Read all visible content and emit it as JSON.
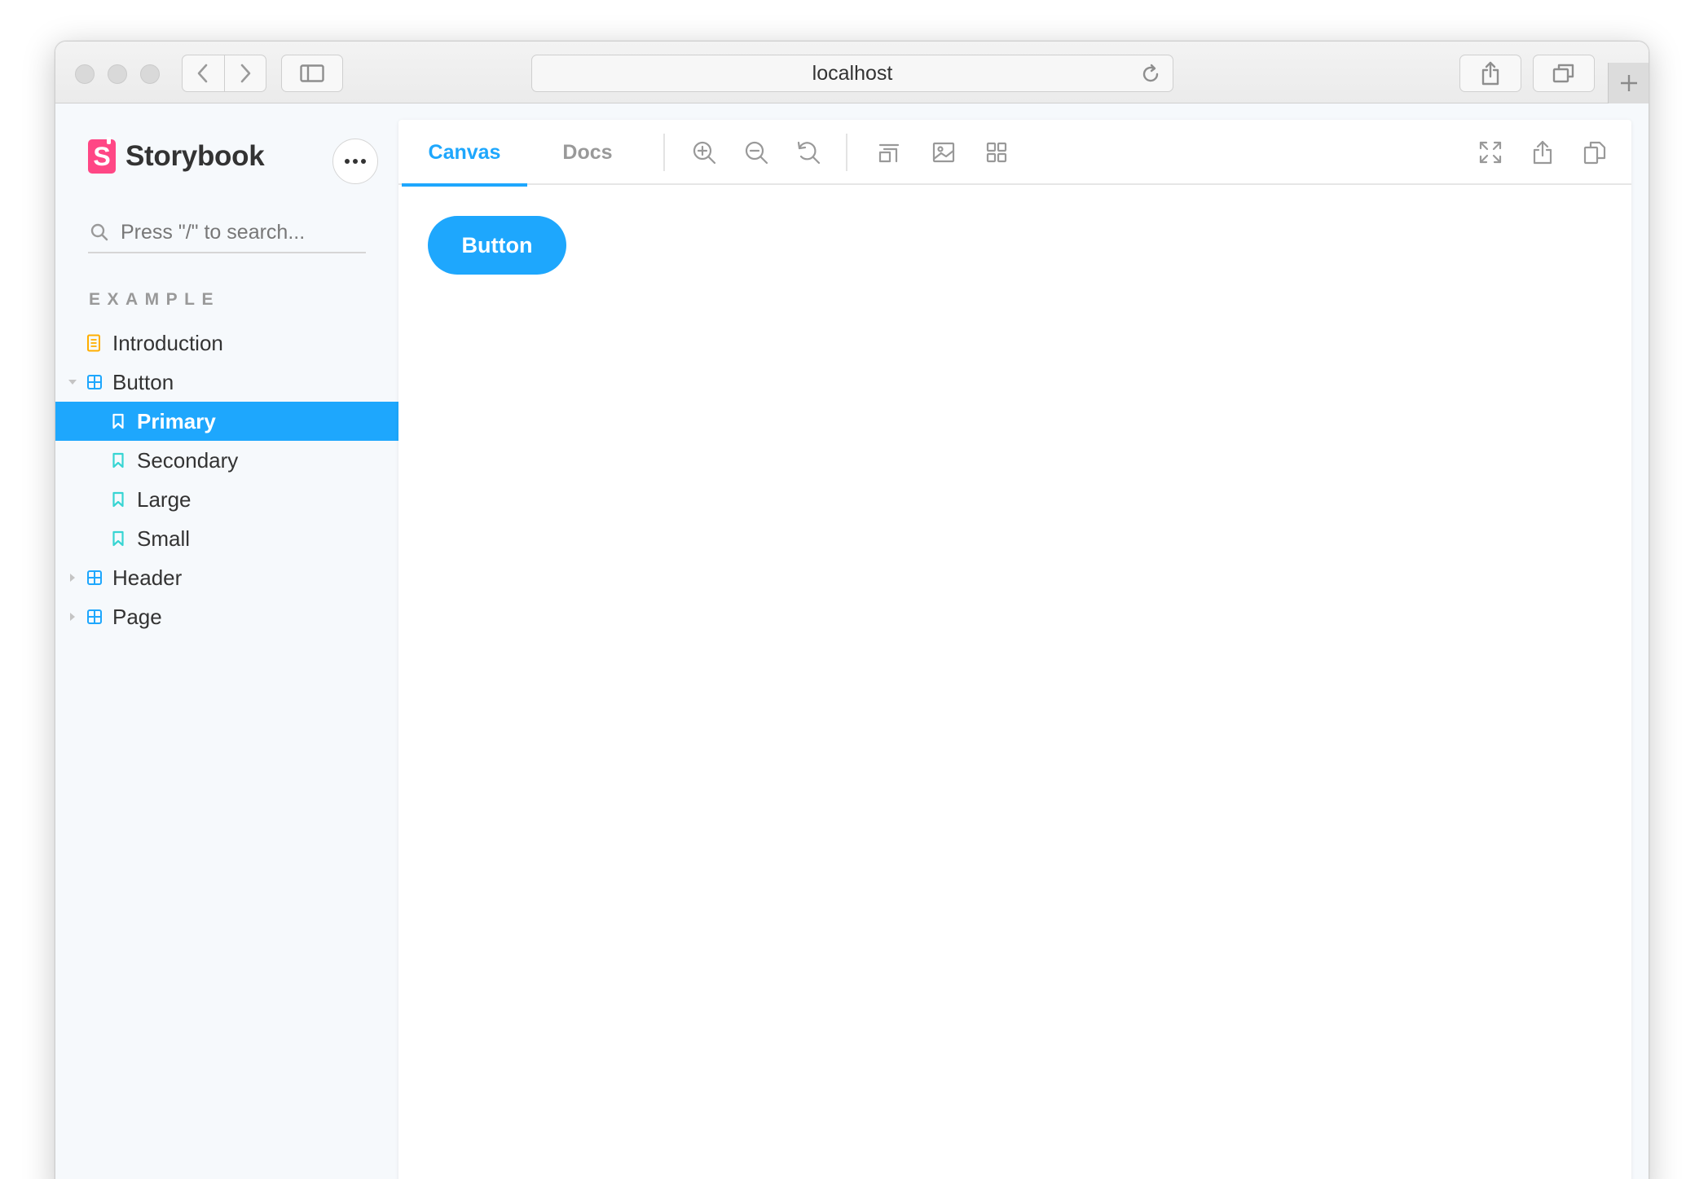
{
  "browser": {
    "address": "localhost"
  },
  "sidebar": {
    "brand": "Storybook",
    "search_placeholder": "Press \"/\" to search...",
    "section": "EXAMPLE",
    "items": [
      {
        "label": "Introduction",
        "icon": "document-icon"
      },
      {
        "label": "Button",
        "icon": "component-icon",
        "expanded": true
      },
      {
        "label": "Primary",
        "icon": "bookmark-icon",
        "selected": true
      },
      {
        "label": "Secondary",
        "icon": "bookmark-icon"
      },
      {
        "label": "Large",
        "icon": "bookmark-icon"
      },
      {
        "label": "Small",
        "icon": "bookmark-icon"
      },
      {
        "label": "Header",
        "icon": "component-icon",
        "expanded": false
      },
      {
        "label": "Page",
        "icon": "component-icon",
        "expanded": false
      }
    ]
  },
  "toolbar": {
    "tabs": [
      {
        "label": "Canvas",
        "active": true
      },
      {
        "label": "Docs",
        "active": false
      }
    ],
    "tools": [
      "zoom-in-icon",
      "zoom-out-icon",
      "zoom-reset-icon",
      "outline-icon",
      "background-icon",
      "grid-icon",
      "fullscreen-icon",
      "share-icon",
      "copy-link-icon"
    ]
  },
  "canvas": {
    "button_label": "Button"
  },
  "colors": {
    "accent": "#1ea7fd",
    "brand": "#ff4785",
    "doc_icon": "#ffae00",
    "component_icon": "#1ea7fd",
    "story_icon": "#37d5d3"
  }
}
